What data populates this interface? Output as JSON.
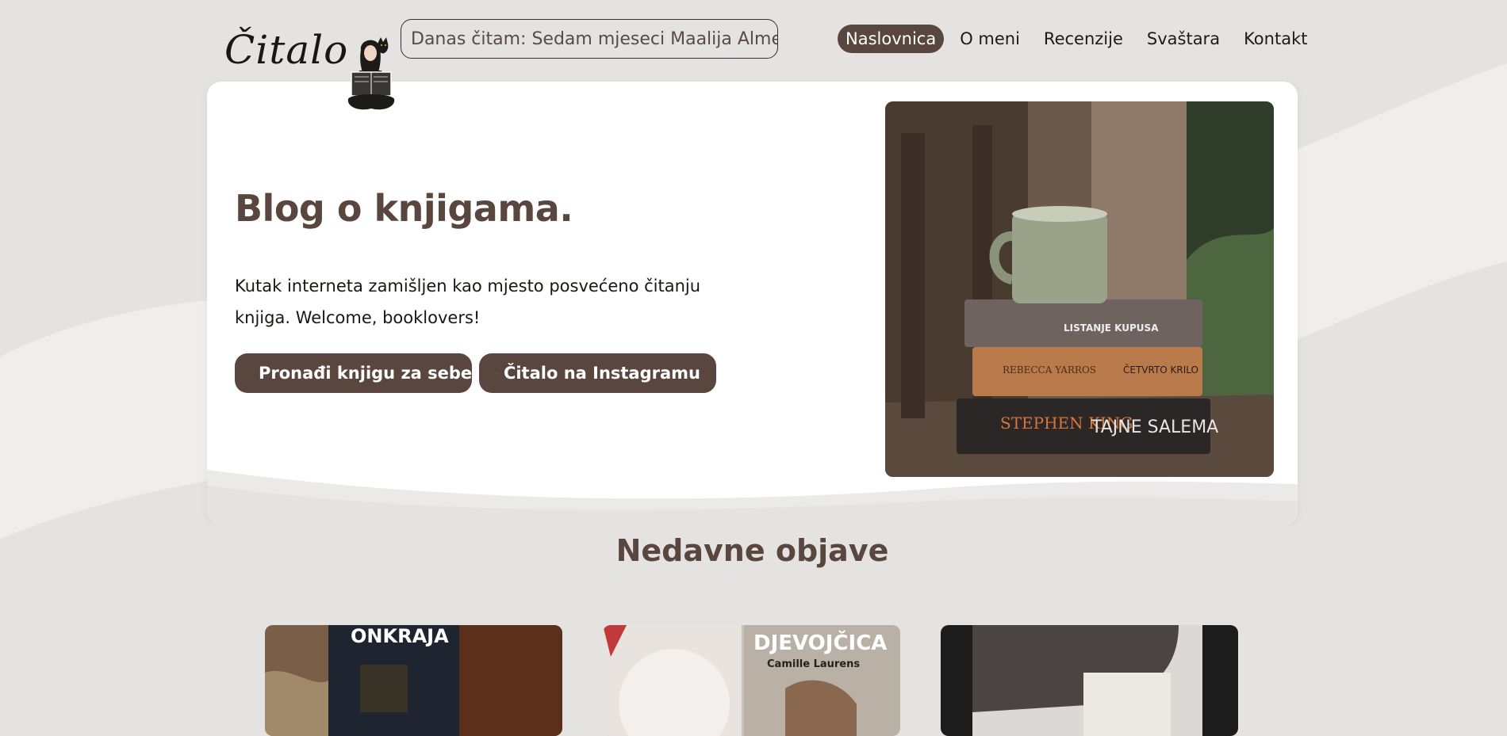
{
  "header": {
    "logo_text": "Čitalo",
    "reading_now": "Danas čitam: Sedam mjeseci Maalija Almeide",
    "nav": [
      {
        "label": "Naslovnica",
        "active": true
      },
      {
        "label": "O meni",
        "active": false
      },
      {
        "label": "Recenzije",
        "active": false
      },
      {
        "label": "Svaštara",
        "active": false
      },
      {
        "label": "Kontakt",
        "active": false
      }
    ]
  },
  "hero": {
    "title": "Blog o knjigama.",
    "description": "Kutak interneta zamišljen kao mjesto posvećeno čitanju knjiga. Welcome, booklovers!",
    "button_find": "Pronađi knjigu za sebe",
    "button_instagram": "Čitalo na Instagramu",
    "photo_books": [
      "LISTANJE KUPUSA",
      "REBECCA YARROS",
      "ČETVRTO KRILO",
      "STEPHEN KING",
      "TAJNE SALEMA"
    ]
  },
  "recent": {
    "title": "Nedavne objave",
    "posts": [
      {
        "cover_text": "ONKRAJA"
      },
      {
        "cover_text": "DJEVOJČICA",
        "cover_author": "Camille Laurens"
      },
      {
        "cover_text": ""
      }
    ]
  },
  "colors": {
    "accent": "#59463f",
    "background": "#e5e3e1",
    "card": "#ffffff"
  },
  "icons": [
    "book-open-icon",
    "instagram-icon"
  ]
}
